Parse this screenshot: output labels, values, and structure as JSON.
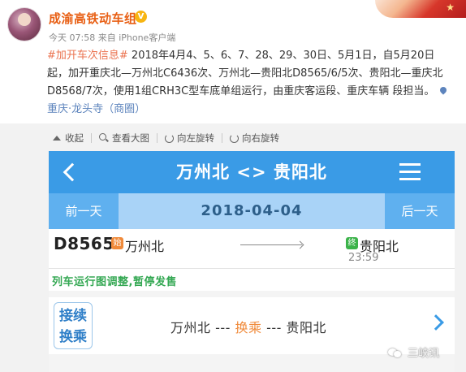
{
  "post": {
    "username": "成渝高铁动车组",
    "verified_mark": "V",
    "meta": "今天 07:58 来自 iPhone客户端",
    "hashtag": "#加开车次信息#",
    "body": " 2018年4月4、5、6、7、28、29、30日、5月1日，自5月20日起，加开重庆北—万州北C6436次、万州北—贵阳北D8565/6/5次、贵阳北—重庆北D8568/7次，使用1组CRH3C型车底单组运行，由重庆客运段、重庆车辆 段担当。",
    "location": "重庆·龙头寺（商圈）"
  },
  "image_toolbar": {
    "collapse": "收起",
    "view_large": "查看大图",
    "rotate_left": "向左旋转",
    "rotate_right": "向右旋转"
  },
  "app": {
    "title": "万州北 <> 贵阳北",
    "prev_day": "前一天",
    "date": "2018-04-04",
    "next_day": "后一天",
    "train": {
      "number": "D8565",
      "start_badge": "始",
      "from": "万州北",
      "end_badge": "终",
      "to": "贵阳北",
      "arrive_time": "23:59"
    },
    "notice": "列车运行图调整,暂停发售",
    "transfer": {
      "button_line1": "接续",
      "button_line2": "换乘",
      "from": "万州北",
      "sep1": " --- ",
      "mid": "换乘",
      "sep2": " --- ",
      "to": "贵阳北"
    }
  },
  "watermark": "三峡讯",
  "colors": {
    "nav_blue": "#3a9be6",
    "date_bar": "#a9d3f7",
    "username_orange": "#e85f14",
    "notice_green": "#34a853",
    "hashtag": "#eb7350"
  }
}
